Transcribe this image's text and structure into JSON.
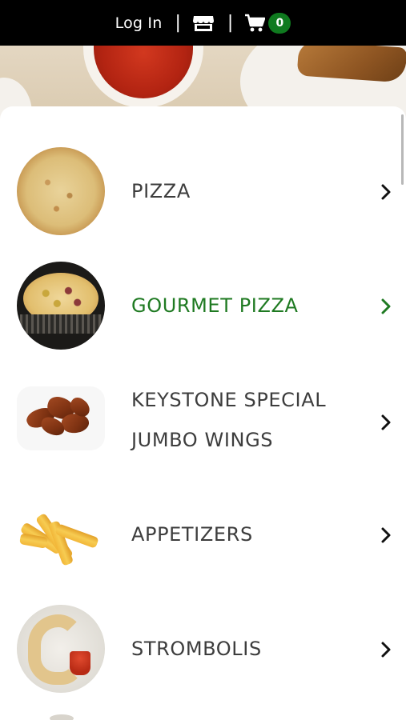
{
  "header": {
    "login_label": "Log In",
    "separator": "|",
    "store_icon": "store-icon",
    "cart_icon": "cart-icon",
    "cart_count": "0",
    "accent_color": "#0f7a1f"
  },
  "menu": {
    "active_color": "#1f7a22",
    "items": [
      {
        "label": "PIZZA",
        "icon": "chevron-right-icon",
        "active": false
      },
      {
        "label": "GOURMET PIZZA",
        "icon": "chevron-right-icon",
        "active": true
      },
      {
        "label_line1": "KEYSTONE SPECIAL",
        "label_line2": "JUMBO WINGS",
        "icon": "chevron-right-icon",
        "active": false
      },
      {
        "label": "APPETIZERS",
        "icon": "chevron-right-icon",
        "active": false
      },
      {
        "label": "STROMBOLIS",
        "icon": "chevron-right-icon",
        "active": false
      }
    ]
  }
}
